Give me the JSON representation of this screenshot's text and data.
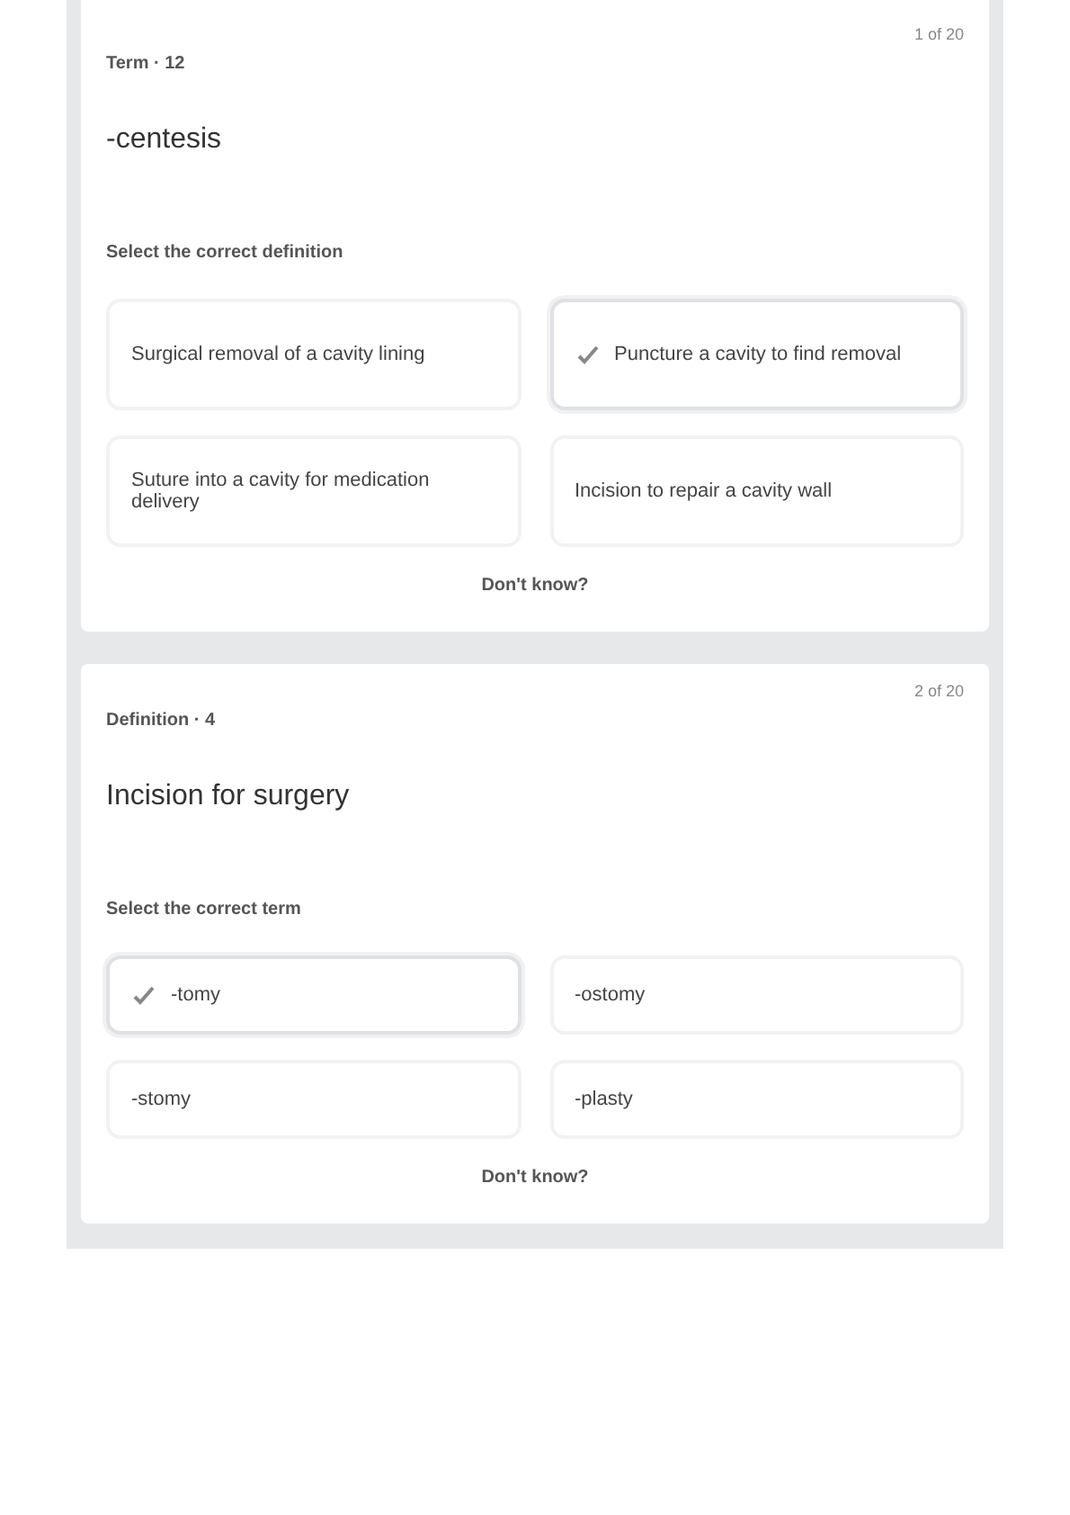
{
  "cards": [
    {
      "counter": "1 of 20",
      "label": "Term · 12",
      "prompt": "-centesis",
      "question": "Select the correct definition",
      "options": [
        {
          "text": "Surgical removal of a cavity lining",
          "selected": false
        },
        {
          "text": "Puncture a cavity to find removal",
          "selected": true
        },
        {
          "text": "Suture into a cavity for medication delivery",
          "selected": false
        },
        {
          "text": "Incision to repair a cavity wall",
          "selected": false
        }
      ],
      "skip": "Don't know?"
    },
    {
      "counter": "2 of 20",
      "label": "Definition · 4",
      "prompt": "Incision for surgery",
      "question": "Select the correct term",
      "options": [
        {
          "text": "-tomy",
          "selected": true
        },
        {
          "text": "-ostomy",
          "selected": false
        },
        {
          "text": "-stomy",
          "selected": false
        },
        {
          "text": "-plasty",
          "selected": false
        }
      ],
      "skip": "Don't know?"
    }
  ]
}
